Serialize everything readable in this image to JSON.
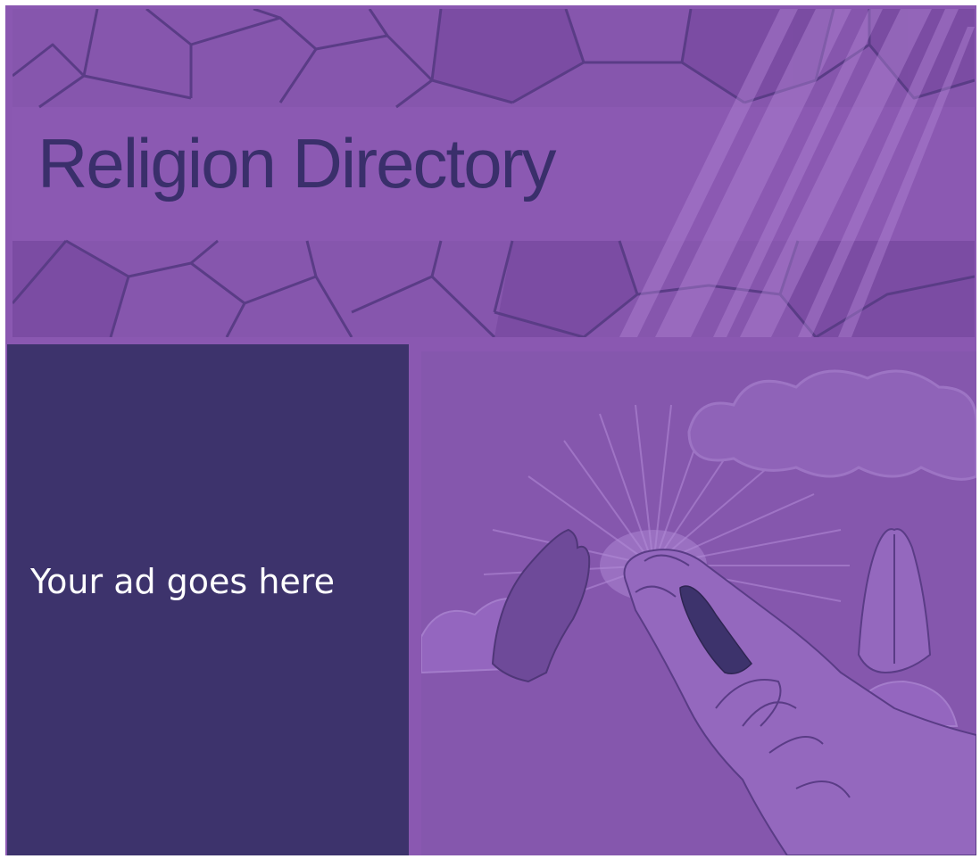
{
  "banner": {
    "title": "Religion Directory"
  },
  "ad": {
    "text": "Your ad goes here"
  },
  "colors": {
    "background": "#8a58b1",
    "title": "#3a2f6b",
    "ad_panel": "#3d336c",
    "ad_text": "#ffffff"
  },
  "icons": {
    "banner_art": "stained-glass-pattern",
    "illustration_art": "praying-hands-with-sunburst"
  }
}
